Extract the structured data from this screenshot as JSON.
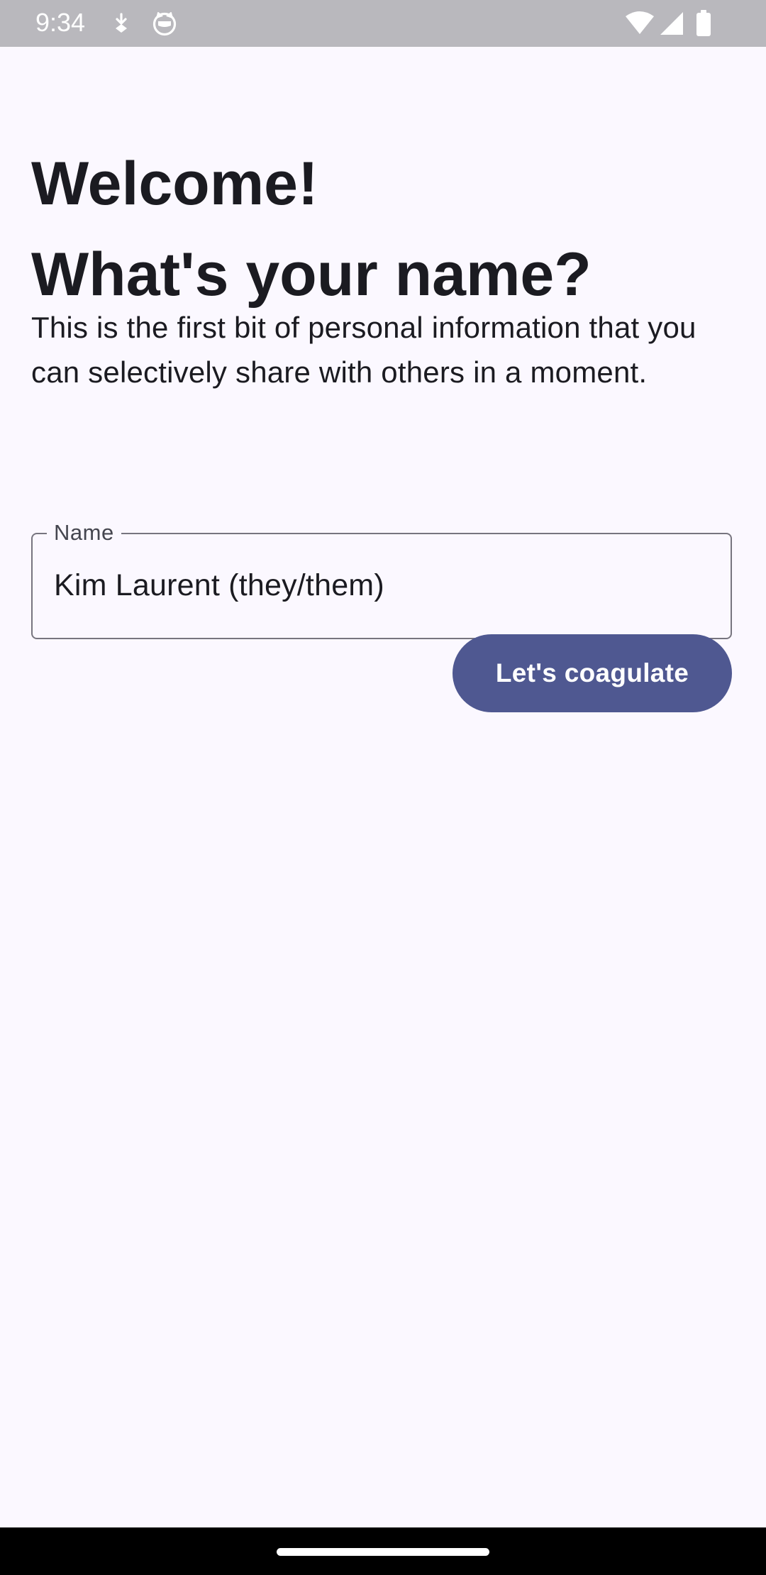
{
  "status_bar": {
    "time": "9:34",
    "left_icons": [
      "download-indicator-icon",
      "cat-face-icon"
    ],
    "right_icons": [
      "wifi-icon",
      "cellular-signal-icon",
      "battery-icon"
    ]
  },
  "onboarding": {
    "heading_line1": "Welcome!",
    "heading_line2": "What's your name?",
    "description": "This is the first bit of personal information that you can selectively share with others in a moment.",
    "name_field": {
      "label": "Name",
      "value": "Kim Laurent (they/them)"
    },
    "continue_button_label": "Let's coagulate"
  },
  "colors": {
    "background": "#fbf8ff",
    "status_bar": "#b9b8bd",
    "primary_button": "#4f5891",
    "text": "#1b1b21",
    "outline": "#77757f",
    "navigation_bar": "#000000"
  }
}
